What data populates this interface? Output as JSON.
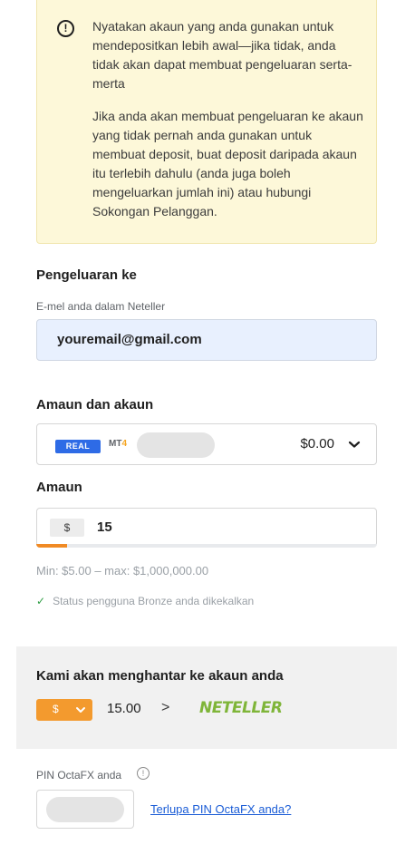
{
  "notice": {
    "paragraph1": "Nyatakan akaun yang anda gunakan untuk mendepositkan lebih awal—jika tidak, anda tidak akan dapat membuat pengeluaran serta-merta",
    "paragraph2": "Jika anda akan membuat pengeluaran ke akaun yang tidak pernah anda gunakan untuk membuat deposit, buat deposit daripada akaun itu terlebih dahulu (anda juga boleh mengeluarkan jumlah ini) atau hubungi Sokongan Pelanggan.",
    "icon": "alert-circle-icon"
  },
  "withdraw_to": {
    "heading": "Pengeluaran ke",
    "email_label": "E-mel anda dalam Neteller",
    "email_value": "youremail@gmail.com"
  },
  "account": {
    "heading": "Amaun dan akaun",
    "badge": "REAL",
    "platform_prefix": "MT",
    "platform_suffix": "4",
    "balance": "$0.00"
  },
  "amount": {
    "heading": "Amaun",
    "currency": "$",
    "value": "15",
    "progress_fraction": 0.09,
    "limits": "Min: $5.00 – max: $1,000,000.00",
    "status_text": "Status pengguna Bronze anda dikekalkan"
  },
  "send_panel": {
    "title": "Kami akan menghantar ke akaun anda",
    "currency": "$",
    "amount": "15.00",
    "arrow": ">",
    "destination_logo": "NETELLER"
  },
  "pin": {
    "label": "PIN OctaFX anda",
    "forgot_link": "Terlupa PIN OctaFX anda?"
  },
  "colors": {
    "notice_bg": "#fdf8d9",
    "email_bg": "#e8f0fe",
    "real_badge": "#2e6be6",
    "accent_orange": "#f39a2e",
    "neteller_green": "#7fb539",
    "link_blue": "#1a5cd6",
    "success_green": "#2e9e44"
  }
}
